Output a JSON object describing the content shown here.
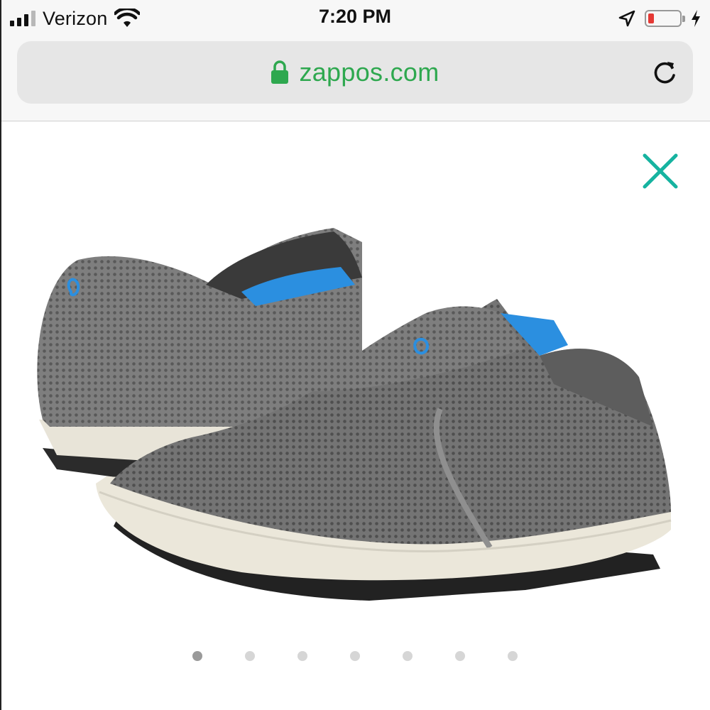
{
  "status_bar": {
    "carrier": "Verizon",
    "time": "7:20 PM",
    "battery_level_percent": 10,
    "battery_color": "#e53935",
    "icons": [
      "signal-icon",
      "wifi-icon",
      "location-arrow-icon",
      "battery-icon",
      "charging-bolt-icon"
    ]
  },
  "browser": {
    "url": "zappos.com",
    "secure": true,
    "url_color": "#2ea84f",
    "icons": [
      "lock-icon",
      "reload-icon"
    ]
  },
  "product_viewer": {
    "image_alt": "gray mesh slip-on shoes",
    "close_icon": "close-icon",
    "close_color": "#16b3a0",
    "carousel": {
      "count": 7,
      "active_index": 0
    }
  }
}
